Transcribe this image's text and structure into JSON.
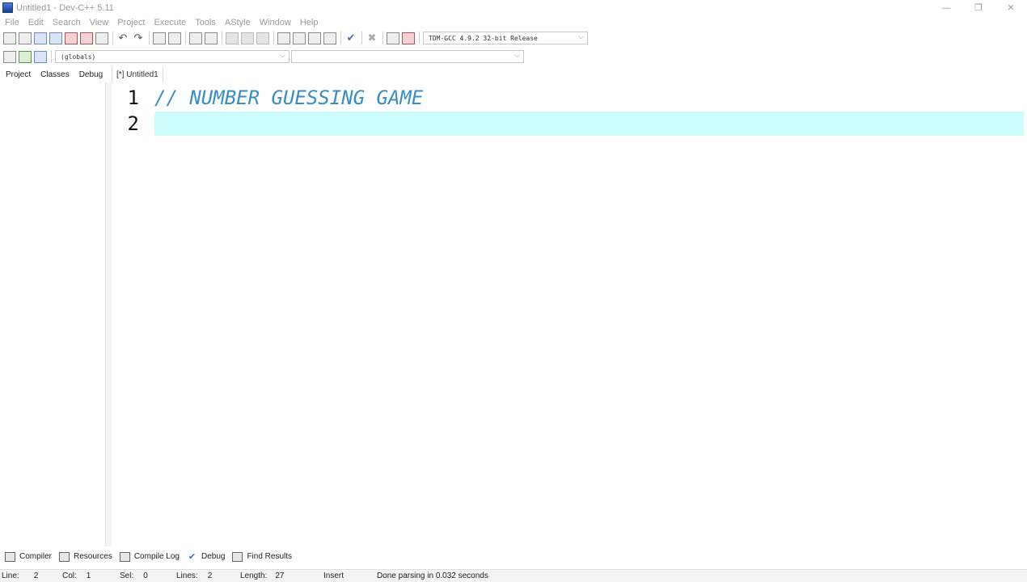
{
  "window": {
    "title": "Untitled1 - Dev-C++ 5.11",
    "minimize": "—",
    "restore": "❐",
    "close": "✕"
  },
  "menu": [
    "File",
    "Edit",
    "Search",
    "View",
    "Project",
    "Execute",
    "Tools",
    "AStyle",
    "Window",
    "Help"
  ],
  "toolbar": {
    "compiler_select": "TDM-GCC 4.9.2 32-bit Release"
  },
  "toolbar2": {
    "scope_select": "(globals)",
    "function_select": ""
  },
  "side_tabs": [
    "Project",
    "Classes",
    "Debug"
  ],
  "editor": {
    "tab_label": "[*] Untitled1",
    "line_numbers": [
      "1",
      "2"
    ],
    "lines": [
      "// NUMBER GUESSING GAME",
      ""
    ]
  },
  "bottom_tabs": [
    "Compiler",
    "Resources",
    "Compile Log",
    "Debug",
    "Find Results"
  ],
  "status": {
    "line_label": "Line:",
    "line_value": "2",
    "col_label": "Col:",
    "col_value": "1",
    "sel_label": "Sel:",
    "sel_value": "0",
    "lines_label": "Lines:",
    "lines_value": "2",
    "length_label": "Length:",
    "length_value": "27",
    "mode": "Insert",
    "message": "Done parsing in 0.032 seconds"
  },
  "colors": {
    "comment": "#3a8ec6",
    "current_line_highlight": "#ccfcfc"
  }
}
